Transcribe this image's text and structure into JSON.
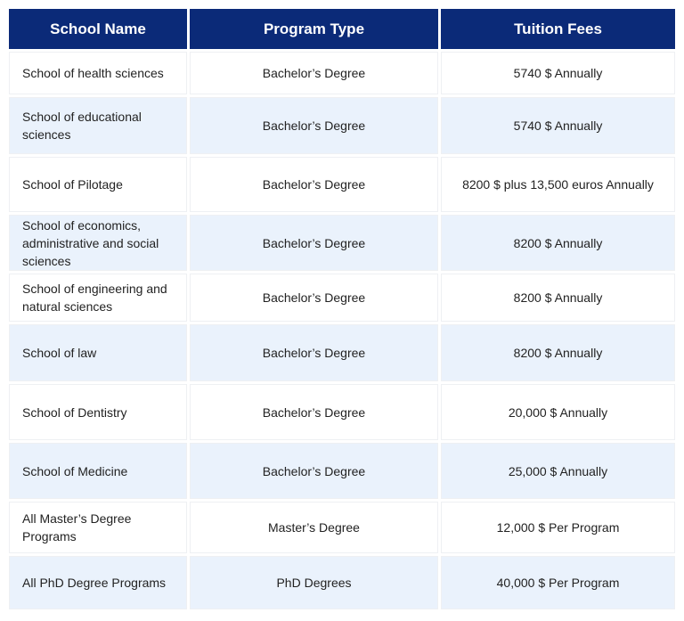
{
  "table": {
    "headers": [
      "School Name",
      "Program Type",
      "Tuition Fees"
    ],
    "rows": [
      {
        "school": "School of health sciences",
        "program": "Bachelor’s Degree",
        "fee": "5740 $ Annually"
      },
      {
        "school": "School of educational sciences",
        "program": "Bachelor’s Degree",
        "fee": "5740 $ Annually"
      },
      {
        "school": "School of Pilotage",
        "program": "Bachelor’s Degree",
        "fee": "8200 $ plus 13,500 euros Annually"
      },
      {
        "school": "School of economics, administrative and social sciences",
        "program": "Bachelor’s Degree",
        "fee": "8200 $ Annually"
      },
      {
        "school": "School of engineering and natural sciences",
        "program": "Bachelor’s Degree",
        "fee": "8200 $ Annually"
      },
      {
        "school": "School of law",
        "program": "Bachelor’s Degree",
        "fee": "8200 $ Annually"
      },
      {
        "school": "School of Dentistry",
        "program": "Bachelor’s Degree",
        "fee": "20,000 $ Annually"
      },
      {
        "school": "School of Medicine",
        "program": "Bachelor’s Degree",
        "fee": "25,000 $ Annually"
      },
      {
        "school": "All Master’s Degree Programs",
        "program": "Master’s Degree",
        "fee": "12,000 $ Per Program"
      },
      {
        "school": "All PhD Degree Programs",
        "program": "PhD Degrees",
        "fee": "40,000 $ Per Program"
      }
    ]
  },
  "colors": {
    "header_bg": "#0b2a78",
    "header_text": "#ffffff",
    "row_alt_bg": "#eaf2fc"
  }
}
